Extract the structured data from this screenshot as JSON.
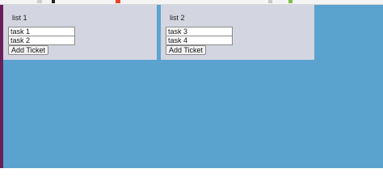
{
  "lists": [
    {
      "title": "list 1",
      "tasks": [
        "task 1",
        "task 2"
      ],
      "add_button_label": "Add Ticket"
    },
    {
      "title": "list 2",
      "tasks": [
        "task 3",
        "task 4"
      ],
      "add_button_label": "Add Ticket"
    }
  ],
  "colors": {
    "page_background": "#5ba3cf",
    "panel_background": "#d3d6e1",
    "left_edge": "#6a1f5a",
    "browser_strip": "#f4f4f4"
  }
}
